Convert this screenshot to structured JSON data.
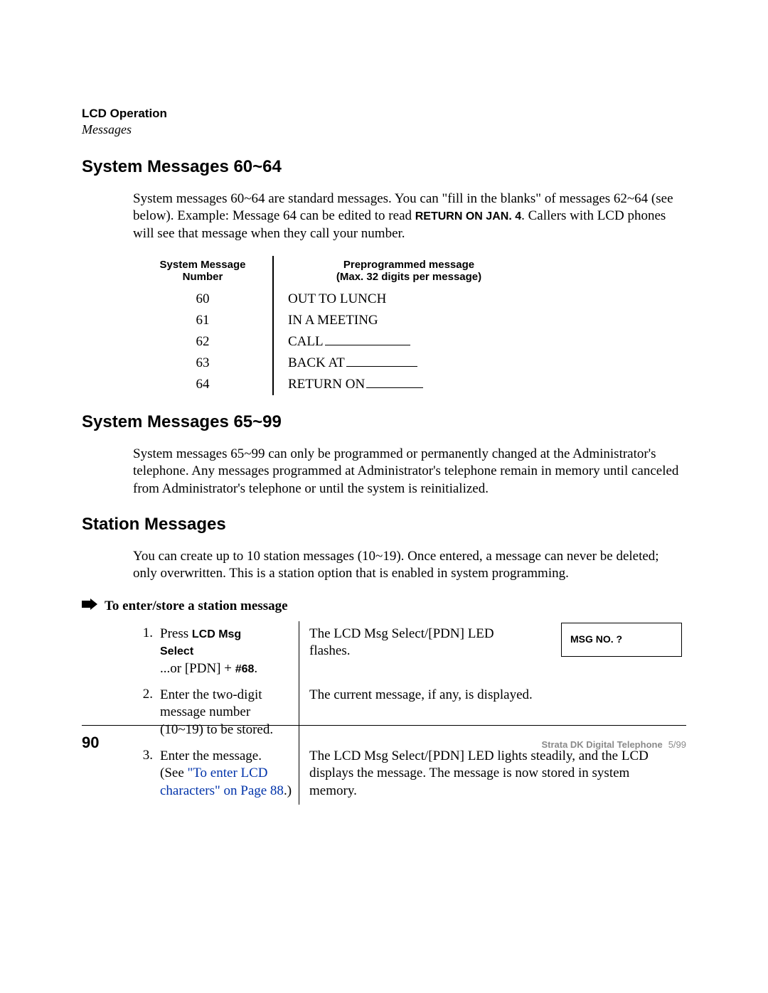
{
  "header": {
    "chapter": "LCD Operation",
    "subsection": "Messages"
  },
  "sec1": {
    "title": "System Messages 60~64",
    "para_a": "System messages 60~64 are standard messages. You can \"fill in the blanks\" of messages 62~64 (see below). Example: Message 64 can be edited to read ",
    "para_inline": "RETURN ON JAN. 4",
    "para_b": ". Callers with LCD phones will see that message when they call your number.",
    "table": {
      "head_left_1": "System Message",
      "head_left_2": "Number",
      "head_right_1": "Preprogrammed message",
      "head_right_2": "Max. 32 digits per message)",
      "rows": [
        {
          "num": "60",
          "text": "OUT TO LUNCH",
          "blank": "none"
        },
        {
          "num": "61",
          "text": "IN A MEETING",
          "blank": "none"
        },
        {
          "num": "62",
          "text": "CALL",
          "blank": "long"
        },
        {
          "num": "63",
          "text": "BACK AT",
          "blank": "short"
        },
        {
          "num": "64",
          "text": "RETURN ON",
          "blank": "shorter"
        }
      ]
    }
  },
  "sec2": {
    "title": "System Messages 65~99",
    "para": "System messages 65~99 can only be programmed or permanently changed at the Administrator's telephone. Any messages programmed at Administrator's telephone remain in memory until canceled from Administrator's telephone or until the system is reinitialized."
  },
  "sec3": {
    "title": "Station Messages",
    "para": "You can create up to 10 station messages (10~19). Once entered, a message can never be deleted; only overwritten. This is a station option that is enabled in system programming."
  },
  "proc": {
    "title": "To enter/store a station message",
    "lcd": "MSG  NO. ?",
    "steps": [
      {
        "num": "1.",
        "left_a": "Press ",
        "left_b1": "LCD Msg",
        "left_b2": "Select",
        "left_c": "...or [PDN] + ",
        "left_d": "#68",
        "left_e": ".",
        "right": "The LCD Msg Select/[PDN] LED flashes."
      },
      {
        "num": "2.",
        "left": "Enter the two-digit message number (10~19) to be stored.",
        "right": "The current message, if any, is displayed."
      },
      {
        "num": "3.",
        "left_a": "Enter the message.",
        "left_b": "(See ",
        "left_link": "\"To enter LCD characters\" on Page 88",
        "left_c": ".)",
        "right": "The LCD Msg Select/[PDN] LED lights steadily, and the LCD displays the message. The message is now stored in system memory."
      }
    ]
  },
  "footer": {
    "page": "90",
    "title": "Strata DK Digital Telephone",
    "date": "5/99"
  }
}
